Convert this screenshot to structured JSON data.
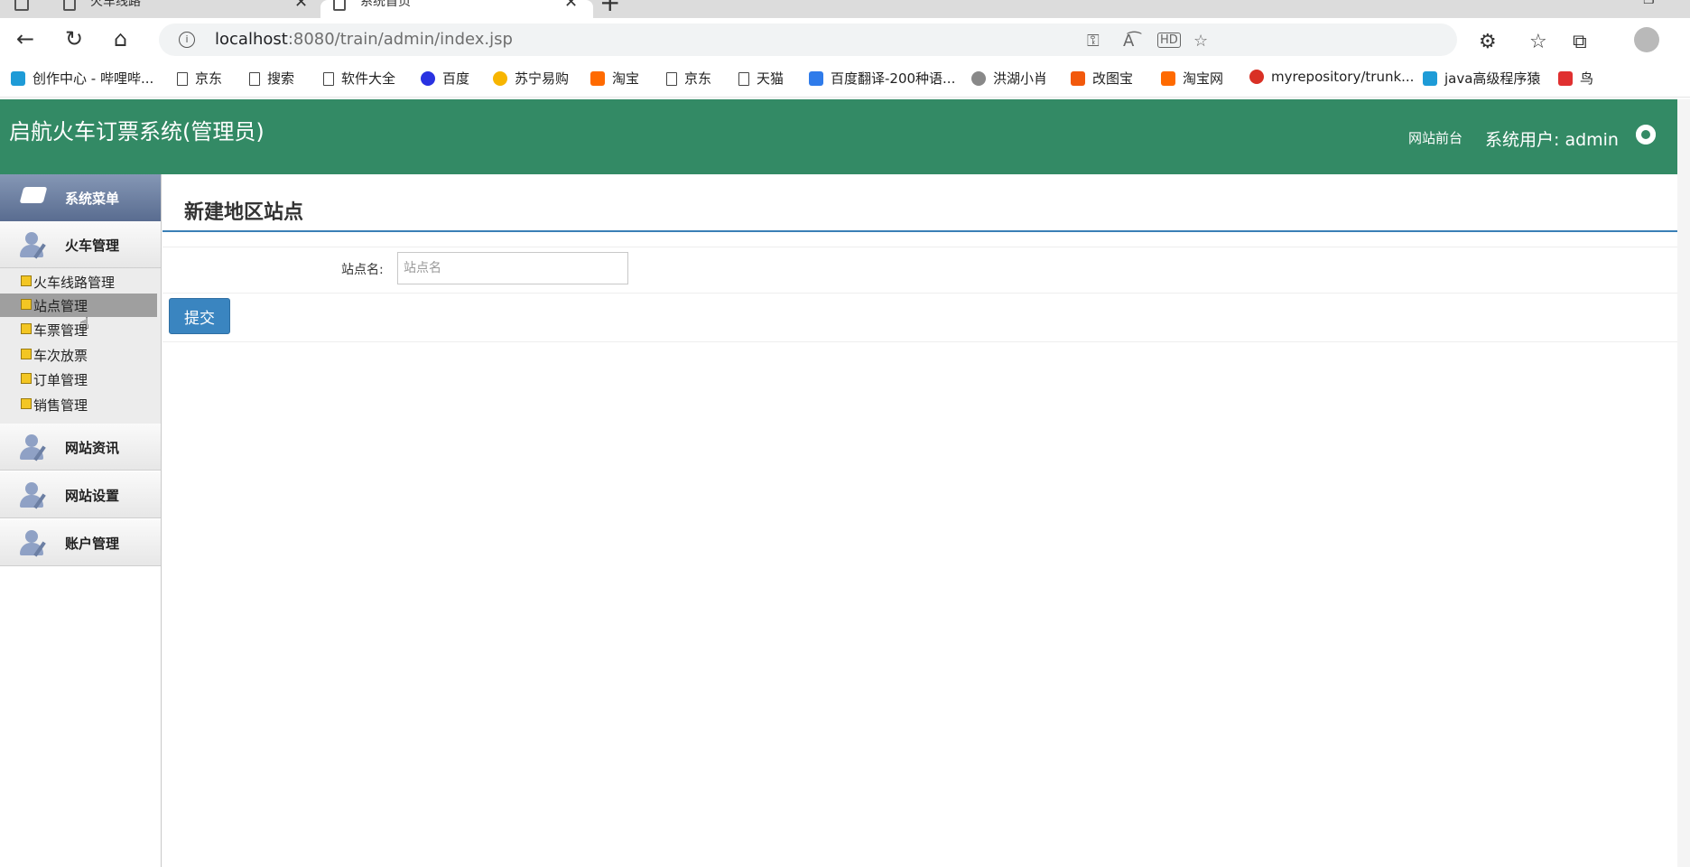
{
  "browser": {
    "tabs": [
      {
        "label": "火车线路"
      },
      {
        "label": "系统首页"
      }
    ],
    "url": {
      "host": "localhost",
      "rest": ":8080/train/admin/index.jsp"
    },
    "bookmarks": [
      {
        "label": "创作中心 - 哔哩哔...",
        "icon": "bilibili-icon",
        "color": "#1e9bd7"
      },
      {
        "label": "京东",
        "icon": "page-icon"
      },
      {
        "label": "搜索",
        "icon": "page-icon"
      },
      {
        "label": "软件大全",
        "icon": "page-icon"
      },
      {
        "label": "百度",
        "icon": "baidu-paw-icon",
        "color": "#2932e1"
      },
      {
        "label": "苏宁易购",
        "icon": "suning-icon",
        "color": "#f7b500"
      },
      {
        "label": "淘宝",
        "icon": "taobao-icon",
        "color": "#ff6a00"
      },
      {
        "label": "京东",
        "icon": "page-icon"
      },
      {
        "label": "天猫",
        "icon": "page-icon"
      },
      {
        "label": "百度翻译-200种语...",
        "icon": "baidu-translate-icon",
        "color": "#2f7bea"
      },
      {
        "label": "洪湖小肖",
        "icon": "bird-icon",
        "color": "#666666"
      },
      {
        "label": "改图宝",
        "icon": "gaitubao-icon",
        "color": "#f2590c"
      },
      {
        "label": "淘宝网",
        "icon": "taobao-icon",
        "color": "#ff6a00"
      },
      {
        "label": "myrepository/trunk...",
        "icon": "chrome-icon",
        "color": "#d93025"
      },
      {
        "label": "java高级程序猿",
        "icon": "bilibili-icon",
        "color": "#1e9bd7"
      },
      {
        "label": "鸟",
        "icon": "bird-red-icon",
        "color": "#e03030"
      }
    ]
  },
  "app": {
    "title": "启航火车订票系统(管理员)",
    "front_link": "网站前台",
    "user_label": "系统用户: admin",
    "header_color": "#338a65"
  },
  "sidebar": {
    "menu_title": "系统菜单",
    "groups": [
      {
        "label": "火车管理"
      },
      {
        "label": "网站资讯"
      },
      {
        "label": "网站设置"
      },
      {
        "label": "账户管理"
      }
    ],
    "sub_items": [
      {
        "label": "火车线路管理",
        "active": false
      },
      {
        "label": "站点管理",
        "active": true
      },
      {
        "label": "车票管理",
        "active": false
      },
      {
        "label": "车次放票",
        "active": false
      },
      {
        "label": "订单管理",
        "active": false
      },
      {
        "label": "销售管理",
        "active": false
      }
    ]
  },
  "main": {
    "page_title": "新建地区站点",
    "field_label": "站点名:",
    "station_input": {
      "value": "",
      "placeholder": "站点名"
    },
    "submit_label": "提交",
    "accent_color": "#3a85c0"
  }
}
